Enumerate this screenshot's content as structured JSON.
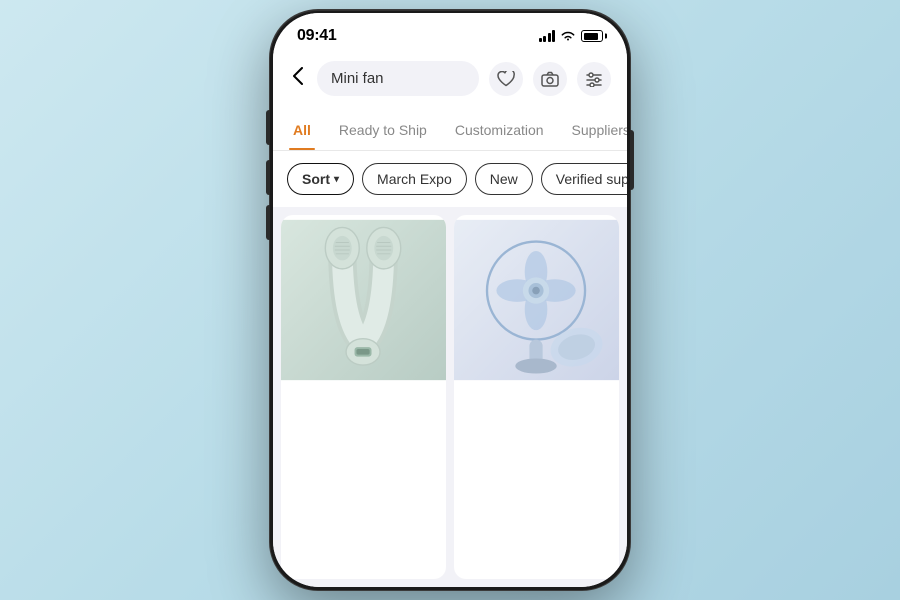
{
  "device": {
    "status_bar": {
      "time": "09:41",
      "signal_label": "signal",
      "wifi_label": "wifi",
      "battery_label": "battery"
    }
  },
  "search": {
    "query": "Mini fan",
    "back_label": "‹",
    "wishlist_label": "♡",
    "camera_label": "⊙",
    "filter_label": "⊞"
  },
  "tabs": [
    {
      "id": "all",
      "label": "All",
      "active": true
    },
    {
      "id": "ready",
      "label": "Ready to Ship",
      "active": false
    },
    {
      "id": "custom",
      "label": "Customization",
      "active": false
    },
    {
      "id": "suppliers",
      "label": "Suppliers",
      "active": false
    }
  ],
  "filters": [
    {
      "id": "sort",
      "label": "Sort",
      "has_chevron": true,
      "active": true
    },
    {
      "id": "march-expo",
      "label": "March Expo",
      "has_chevron": false,
      "active": false
    },
    {
      "id": "new",
      "label": "New",
      "has_chevron": false,
      "active": false
    },
    {
      "id": "verified",
      "label": "Verified suppliers",
      "has_chevron": false,
      "active": false
    }
  ],
  "products": [
    {
      "id": "neck-fan",
      "alt": "Neck fan wearable bladeless"
    },
    {
      "id": "desk-fan",
      "alt": "Small handheld desk fan blue"
    }
  ],
  "colors": {
    "accent": "#e07b20",
    "active_tab_underline": "#e07b20",
    "chip_border": "#333333",
    "background": "#f2f2f7"
  }
}
